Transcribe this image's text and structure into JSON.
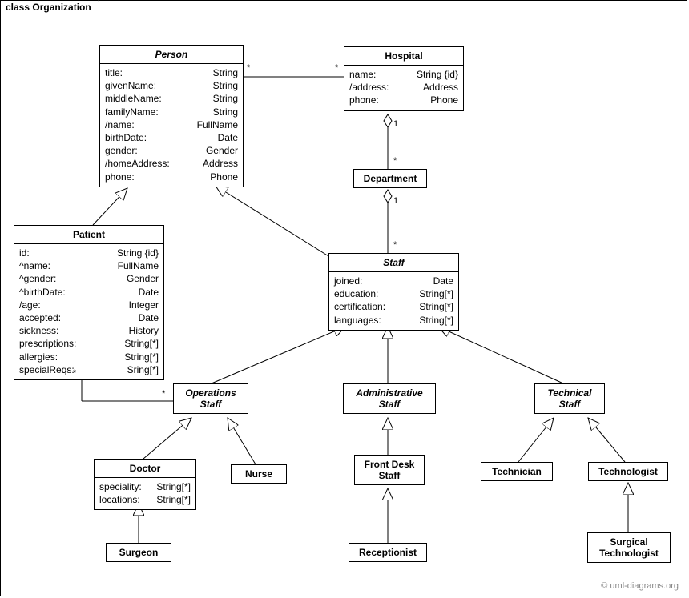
{
  "frame": {
    "label": "class Organization"
  },
  "copyright": "© uml-diagrams.org",
  "classes": {
    "person": {
      "name": "Person",
      "attrs": [
        {
          "n": "title:",
          "t": "String"
        },
        {
          "n": "givenName:",
          "t": "String"
        },
        {
          "n": "middleName:",
          "t": "String"
        },
        {
          "n": "familyName:",
          "t": "String"
        },
        {
          "n": "/name:",
          "t": "FullName"
        },
        {
          "n": "birthDate:",
          "t": "Date"
        },
        {
          "n": "gender:",
          "t": "Gender"
        },
        {
          "n": "/homeAddress:",
          "t": "Address"
        },
        {
          "n": "phone:",
          "t": "Phone"
        }
      ]
    },
    "hospital": {
      "name": "Hospital",
      "attrs": [
        {
          "n": "name:",
          "t": "String {id}"
        },
        {
          "n": "/address:",
          "t": "Address"
        },
        {
          "n": "phone:",
          "t": "Phone"
        }
      ]
    },
    "department": {
      "name": "Department"
    },
    "patient": {
      "name": "Patient",
      "attrs": [
        {
          "n": "id:",
          "t": "String {id}"
        },
        {
          "n": "^name:",
          "t": "FullName"
        },
        {
          "n": "^gender:",
          "t": "Gender"
        },
        {
          "n": "^birthDate:",
          "t": "Date"
        },
        {
          "n": "/age:",
          "t": "Integer"
        },
        {
          "n": "accepted:",
          "t": "Date"
        },
        {
          "n": "sickness:",
          "t": "History"
        },
        {
          "n": "prescriptions:",
          "t": "String[*]"
        },
        {
          "n": "allergies:",
          "t": "String[*]"
        },
        {
          "n": "specialReqs:",
          "t": "Sring[*]"
        }
      ]
    },
    "staff": {
      "name": "Staff",
      "attrs": [
        {
          "n": "joined:",
          "t": "Date"
        },
        {
          "n": "education:",
          "t": "String[*]"
        },
        {
          "n": "certification:",
          "t": "String[*]"
        },
        {
          "n": "languages:",
          "t": "String[*]"
        }
      ]
    },
    "opsStaff": {
      "name1": "Operations",
      "name2": "Staff"
    },
    "adminStaff": {
      "name1": "Administrative",
      "name2": "Staff"
    },
    "techStaff": {
      "name1": "Technical",
      "name2": "Staff"
    },
    "doctor": {
      "name": "Doctor",
      "attrs": [
        {
          "n": "speciality:",
          "t": "String[*]"
        },
        {
          "n": "locations:",
          "t": "String[*]"
        }
      ]
    },
    "nurse": {
      "name": "Nurse"
    },
    "frontDesk": {
      "name1": "Front Desk",
      "name2": "Staff"
    },
    "technician": {
      "name": "Technician"
    },
    "technologist": {
      "name": "Technologist"
    },
    "surgeon": {
      "name": "Surgeon"
    },
    "receptionist": {
      "name": "Receptionist"
    },
    "surgTech": {
      "name1": "Surgical",
      "name2": "Technologist"
    }
  },
  "mult": {
    "personHospL": "*",
    "personHospR": "*",
    "hospDeptTop": "1",
    "hospDeptBot": "*",
    "deptStaffTop": "1",
    "deptStaffBot": "*",
    "patientOps1": "*",
    "patientOps2": "*"
  }
}
